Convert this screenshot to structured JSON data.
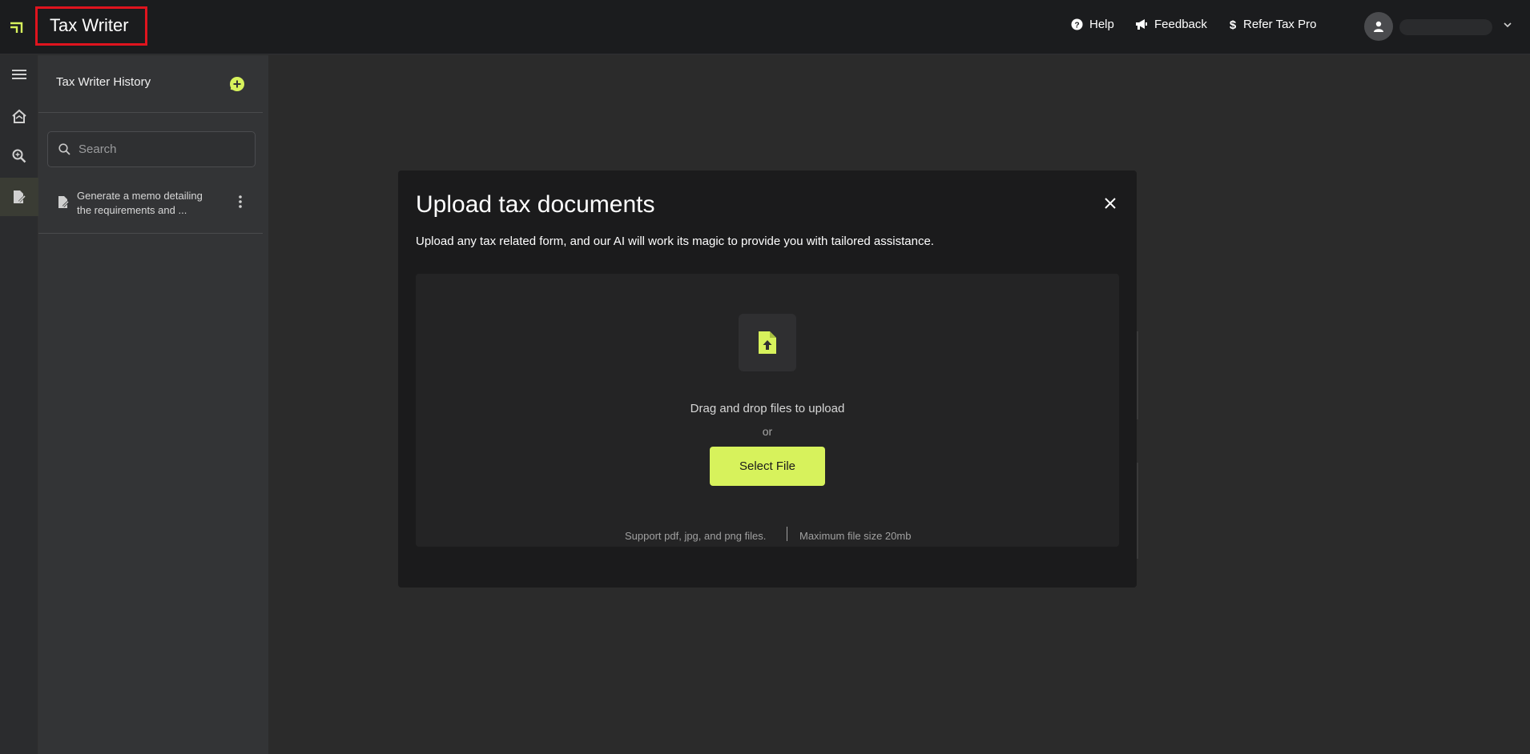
{
  "app": {
    "title": "Tax Writer"
  },
  "topnav": {
    "help": "Help",
    "feedback": "Feedback",
    "refer": "Refer Tax Pro"
  },
  "user": {
    "name": ""
  },
  "history": {
    "title": "Tax Writer History",
    "search_placeholder": "Search",
    "items": [
      {
        "label": "Generate a memo detailing the requirements and ..."
      }
    ]
  },
  "modal": {
    "title": "Upload tax documents",
    "subtitle": "Upload any tax related form, and our AI will work its magic to provide you with tailored assistance.",
    "drag_text": "Drag and drop files to upload",
    "or_text": "or",
    "select_label": "Select File",
    "support_text": "Support pdf, jpg, and png files.",
    "max_size_text": "Maximum file size 20mb"
  },
  "colors": {
    "accent": "#d7f25c",
    "topbar": "#1b1c1e",
    "panel": "#333436",
    "modal": "#1b1b1c",
    "highlight_box": "#e0141e"
  },
  "icons": [
    "logo-icon",
    "help-icon",
    "feedback-megaphone-icon",
    "dollar-icon",
    "user-icon",
    "chevron-down-icon",
    "menu-icon",
    "home-icon",
    "search-zoom-icon",
    "document-edit-icon",
    "new-chat-icon",
    "search-icon",
    "document-icon",
    "kebab-icon",
    "close-icon",
    "file-upload-icon"
  ]
}
